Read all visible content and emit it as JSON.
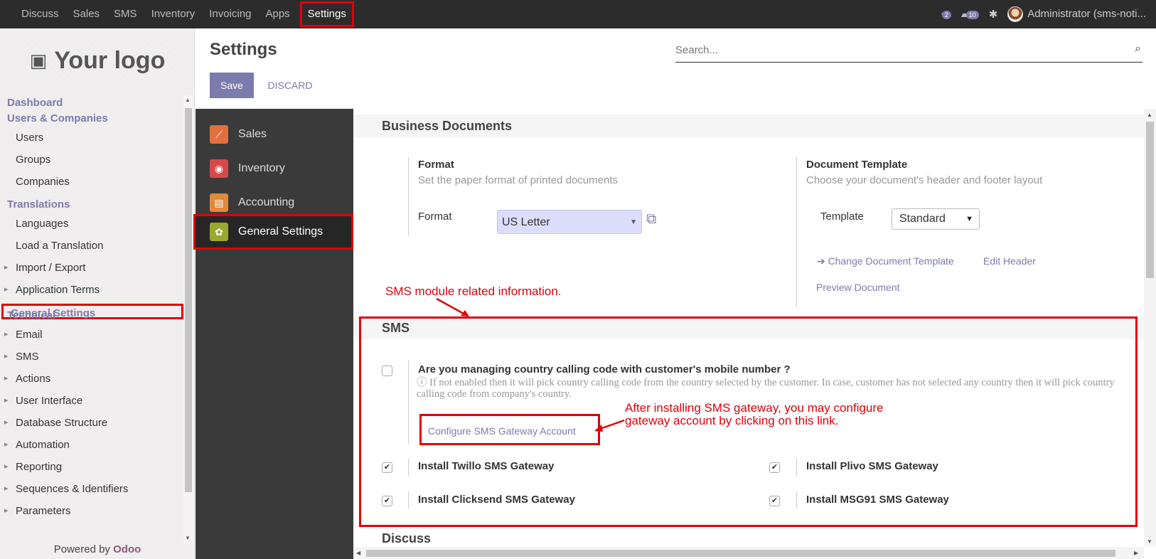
{
  "topbar": {
    "menu": [
      "Discuss",
      "Sales",
      "SMS",
      "Inventory",
      "Invoicing",
      "Apps"
    ],
    "active_menu": "Settings",
    "chat_count": "2",
    "activity_count": "10",
    "user": "Administrator (sms-noti..."
  },
  "sidebar": {
    "logo_text": "Your logo",
    "dashboard": "Dashboard",
    "users_companies": "Users & Companies",
    "users": "Users",
    "groups": "Groups",
    "companies": "Companies",
    "translations": "Translations",
    "languages": "Languages",
    "load_translation": "Load a Translation",
    "import_export": "Import / Export",
    "application_terms": "Application Terms",
    "general_settings": "General Settings",
    "technical": "Technical",
    "email": "Email",
    "sms": "SMS",
    "actions": "Actions",
    "user_interface": "User Interface",
    "database_structure": "Database Structure",
    "automation": "Automation",
    "reporting": "Reporting",
    "sequences": "Sequences & Identifiers",
    "parameters": "Parameters",
    "powered_prefix": "Powered by",
    "powered_brand": "Odoo"
  },
  "control": {
    "title": "Settings",
    "save": "Save",
    "discard": "DISCARD",
    "search_placeholder": "Search..."
  },
  "apps": [
    "Sales",
    "Inventory",
    "Accounting",
    "General Settings"
  ],
  "business_docs": {
    "heading": "Business Documents",
    "format_label": "Format",
    "format_desc": "Set the paper format of printed documents",
    "format_field": "Format",
    "format_value": "US Letter",
    "template_label": "Document Template",
    "template_desc": "Choose your document's header and footer layout",
    "template_field": "Template",
    "template_value": "Standard",
    "change_template": "Change Document Template",
    "edit_header": "Edit Header",
    "preview": "Preview Document"
  },
  "sms": {
    "heading": "SMS",
    "question": "Are you managing country calling code with customer's mobile number ?",
    "help": "If not enabled then it will pick country calling code from the country selected by the customer. In case, customer has not selected any country then it will pick country calling code from company's country.",
    "configure_link": "Configure SMS Gateway Account",
    "twilio": "Install Twillo SMS Gateway",
    "plivo": "Install Plivo SMS Gateway",
    "clicksend": "Install Clicksend SMS Gateway",
    "msg91": "Install MSG91 SMS Gateway"
  },
  "discuss_heading": "Discuss",
  "annotations": {
    "sms_info": "SMS module related information.",
    "gateway_line1": "After installing SMS gateway, you may configure",
    "gateway_line2": "gateway account by clicking on this link."
  },
  "colors": {
    "accent": "#7c7bad",
    "highlight": "#e0000a",
    "navbar": "#2c2c2c"
  }
}
